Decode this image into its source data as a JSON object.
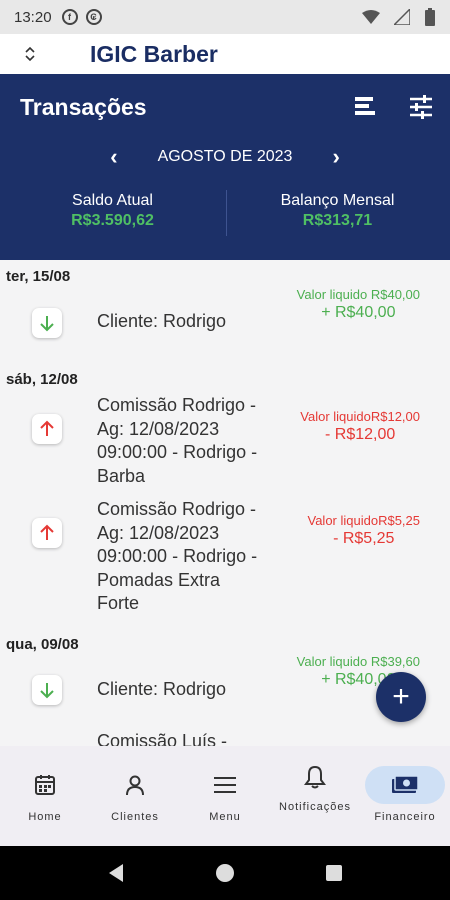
{
  "status_bar": {
    "time": "13:20"
  },
  "app_bar": {
    "title": "IGIC Barber"
  },
  "header": {
    "title": "Transações",
    "month": "AGOSTO DE 2023",
    "saldo_label": "Saldo Atual",
    "saldo_value": "R$3.590,62",
    "balanco_label": "Balanço Mensal",
    "balanco_value": "R$313,71"
  },
  "groups": [
    {
      "date": "ter, 15/08",
      "items": [
        {
          "type": "in",
          "description": "Cliente: Rodrigo",
          "net": "Valor liquido R$40,00",
          "amount": "+ R$40,00"
        }
      ]
    },
    {
      "date": "sáb, 12/08",
      "items": [
        {
          "type": "out",
          "description": "Comissão Rodrigo - Ag: 12/08/2023 09:00:00 - Rodrigo - Barba",
          "net": "Valor liquidoR$12,00",
          "amount": "- R$12,00"
        },
        {
          "type": "out",
          "description": "Comissão Rodrigo - Ag: 12/08/2023 09:00:00 - Rodrigo - Pomadas Extra Forte",
          "net": "Valor liquidoR$5,25",
          "amount": "- R$5,25"
        }
      ]
    },
    {
      "date": "qua, 09/08",
      "items": [
        {
          "type": "in",
          "description": "Cliente: Rodrigo",
          "net": "Valor liquido R$39,60",
          "amount": "+ R$40,00"
        },
        {
          "type": "out",
          "description": "Comissão Luís -",
          "net": "",
          "amount": ""
        }
      ]
    }
  ],
  "fab": {
    "label": "+"
  },
  "bottom_nav": [
    {
      "label": "Home",
      "icon": "calendar-icon"
    },
    {
      "label": "Clientes",
      "icon": "person-icon"
    },
    {
      "label": "Menu",
      "icon": "menu-icon"
    },
    {
      "label": "Notificações",
      "icon": "bell-icon"
    },
    {
      "label": "Financeiro",
      "icon": "cash-icon",
      "active": true
    }
  ],
  "colors": {
    "header_bg": "#1c3068",
    "positive": "#4caf50",
    "negative": "#e53935",
    "balance_green": "#4fbf64",
    "active_nav": "#cfe0f5"
  }
}
